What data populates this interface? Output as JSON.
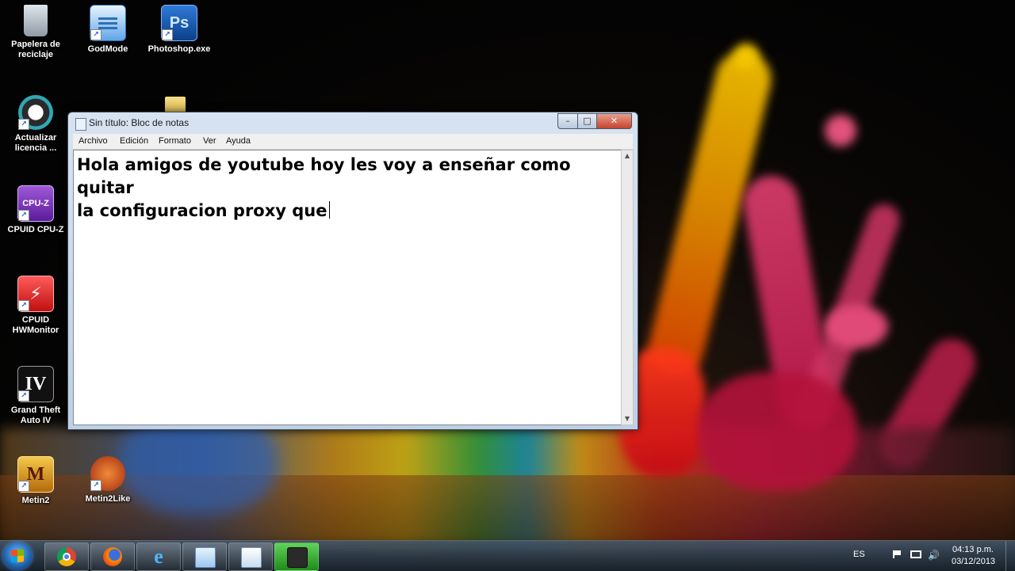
{
  "desktop": {
    "icons": [
      {
        "label_line1": "Papelera de",
        "label_line2": "reciclaje",
        "icon": "recycle-bin-icon"
      },
      {
        "label_line1": "GodMode",
        "label_line2": "",
        "icon": "control-panel-icon"
      },
      {
        "label_line1": "Photoshop.exe",
        "label_line2": "",
        "icon": "photoshop-icon",
        "glyph": "Ps"
      },
      {
        "label_line1": "Actualizar",
        "label_line2": "licencia ...",
        "icon": "license-update-icon"
      },
      {
        "label_line1": "CPUID CPU-Z",
        "label_line2": "",
        "icon": "cpuz-icon",
        "glyph": "CPU-Z"
      },
      {
        "label_line1": "CPUID",
        "label_line2": "HWMonitor",
        "icon": "hwmonitor-icon"
      },
      {
        "label_line1": "Grand Theft",
        "label_line2": "Auto IV",
        "icon": "gta-iv-icon",
        "glyph": "IV"
      },
      {
        "label_line1": "Metin2",
        "label_line2": "",
        "icon": "metin2-icon",
        "glyph": "M"
      },
      {
        "label_line1": "Metin2Like",
        "label_line2": "",
        "icon": "metin2like-icon"
      }
    ]
  },
  "notepad": {
    "title": "Sin título: Bloc de notas",
    "menu": [
      "Archivo",
      "Edición",
      "Formato",
      "Ver",
      "Ayuda"
    ],
    "content_line1": "Hola amigos de youtube hoy les voy a enseñar como quitar",
    "content_line2": "la configuracion proxy que",
    "controls": {
      "minimize": "–",
      "maximize": "□",
      "close": "✕"
    }
  },
  "taskbar": {
    "apps": [
      "chrome-icon",
      "firefox-icon",
      "internet-explorer-icon",
      "notepad-icon",
      "file-icon",
      "camtasia-recorder-icon"
    ],
    "language": "ES",
    "time": "04:13 p.m.",
    "date": "03/12/2013"
  },
  "colors": {
    "accent": "#1a5ca8",
    "close_button": "#c7432b"
  }
}
